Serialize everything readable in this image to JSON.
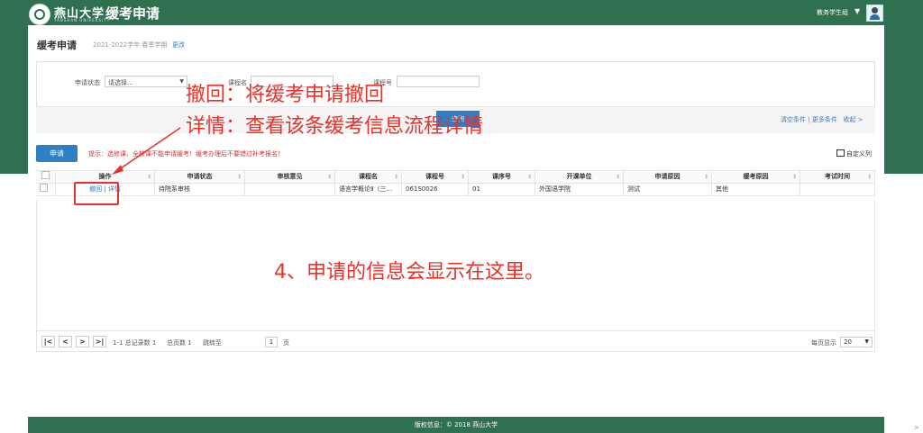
{
  "header": {
    "brand_name": "燕山大学",
    "brand_sub": "YANSHAN UNIVERSITY",
    "app_title": "缓考申请",
    "user_menu": "教务学生组",
    "caret": "▼"
  },
  "page": {
    "title": "缓考申请",
    "term": "2021-2022学年 春季学期",
    "change_link": "更改"
  },
  "search": {
    "status_label": "申请状态",
    "status_value": "请选择...",
    "course_name_label": "课程名",
    "course_no_label": "课程号",
    "query_button": "查询",
    "clear_link": "清空条件",
    "more_link": "更多条件",
    "collapse_link": "收起 >",
    "sep": "|"
  },
  "toolbar": {
    "apply_button": "申请",
    "tip": "提示：选修课、全校课不能申请缓考！缓考办理后不要错过补考报名！",
    "custom_columns": "自定义列"
  },
  "table": {
    "columns": [
      "操作",
      "申请状态",
      "审核意见",
      "课程名",
      "课程号",
      "课序号",
      "开课单位",
      "申请原因",
      "缓考原因",
      "考试时间"
    ],
    "rows": [
      {
        "op_withdraw": "撤回",
        "op_sep": "|",
        "op_detail": "详情",
        "status": "待院系审核",
        "review": "",
        "course_name": "语言学概论Ⅱ（三...",
        "course_no": "061S0026",
        "seq_no": "01",
        "department": "外国语学院",
        "apply_reason": "测试",
        "defer_reason": "其他",
        "exam_time": ""
      }
    ]
  },
  "pager": {
    "first": "|<",
    "prev": "<",
    "next": ">",
    "last": ">|",
    "summary": "1-1 总记录数 1",
    "total_pages": "总页数 1",
    "jump_label": "跳转至",
    "jump_value": "1",
    "page_unit": "页",
    "page_size_label": "每页显示",
    "page_size_value": "20"
  },
  "footer": {
    "copyright": "版权信息：© 2018 燕山大学"
  },
  "annotations": {
    "withdraw_note": "撤回：将缓考申请撤回",
    "detail_note": "详情：查看该条缓考信息流程详情",
    "info_note": "4、申请的信息会显示在这里。"
  },
  "colors": {
    "brand_green": "#2f7050",
    "primary_blue": "#2d80c5",
    "annotation_red": "#e8312a"
  }
}
